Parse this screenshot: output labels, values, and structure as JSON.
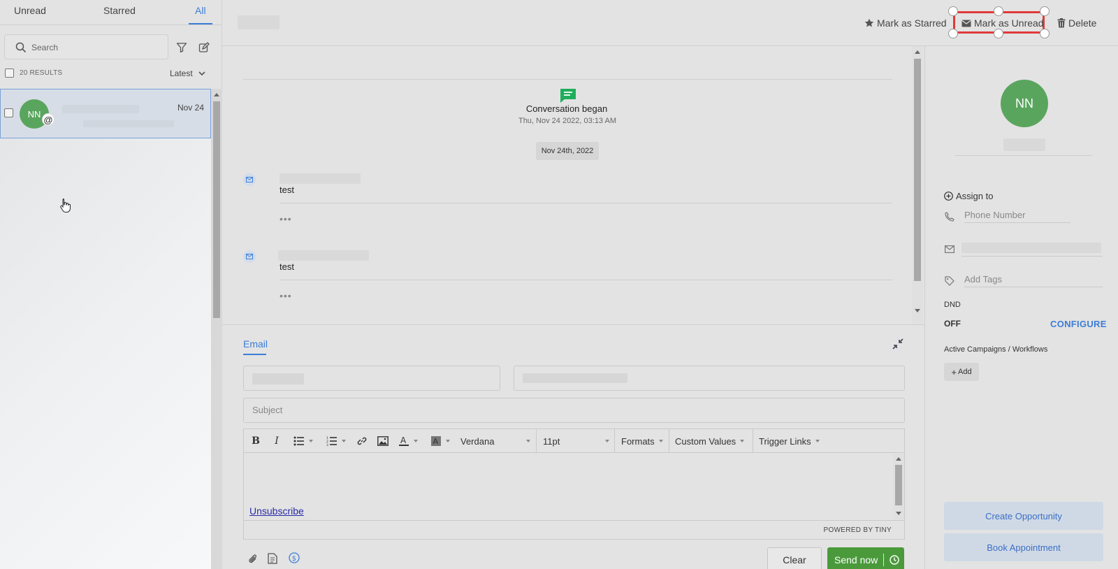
{
  "tabs": [
    {
      "label": "Unread"
    },
    {
      "label": "Starred"
    },
    {
      "label": "All"
    }
  ],
  "search": {
    "placeholder": "Search"
  },
  "list": {
    "results_label": "20 RESULTS",
    "sort_label": "Latest",
    "items": [
      {
        "initials": "NN",
        "badge": "@",
        "date": "Nov 24"
      }
    ]
  },
  "header": {
    "mark_starred": "Mark as Starred",
    "mark_unread": "Mark as Unread",
    "delete": "Delete"
  },
  "thread": {
    "began_title": "Conversation began",
    "began_date": "Thu, Nov 24 2022, 03:13 AM",
    "date_chip": "Nov 24th, 2022",
    "messages": [
      {
        "text": "test",
        "more": "•••"
      },
      {
        "text": "test",
        "more": "•••"
      }
    ]
  },
  "composer": {
    "tab_label": "Email",
    "subject_placeholder": "Subject",
    "font_name": "Verdana",
    "font_size": "11pt",
    "formats_label": "Formats",
    "custom_values_label": "Custom Values",
    "trigger_links_label": "Trigger Links",
    "unsubscribe": "Unsubscribe",
    "powered_by": "POWERED BY TINY",
    "clear_label": "Clear",
    "send_label": "Send now"
  },
  "contact": {
    "initials": "NN",
    "assign_label": "Assign to",
    "phone_placeholder": "Phone Number",
    "tags_placeholder": "Add Tags",
    "dnd_label": "DND",
    "dnd_value": "OFF",
    "configure_label": "CONFIGURE",
    "campaigns_label": "Active Campaigns / Workflows",
    "add_label": "Add",
    "create_opportunity": "Create Opportunity",
    "book_appointment": "Book Appointment"
  },
  "colors": {
    "accent": "#3b7dd8",
    "avatar": "#5aa55e",
    "send": "#4a9a3c",
    "selection": "#e03a3a"
  }
}
